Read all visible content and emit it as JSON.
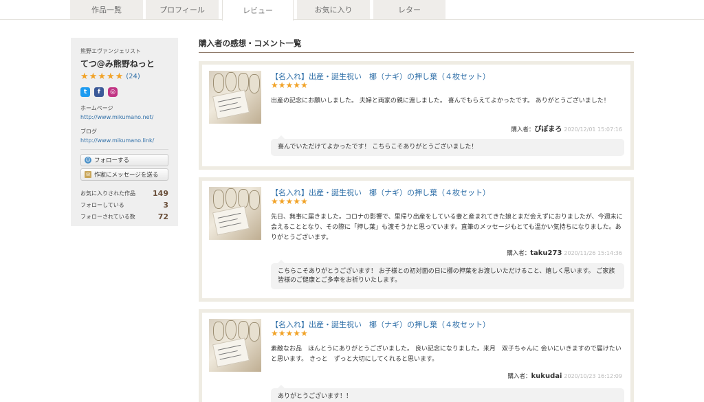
{
  "tabs": [
    {
      "label": "作品一覧",
      "active": false
    },
    {
      "label": "プロフィール",
      "active": false
    },
    {
      "label": "レビュー",
      "active": true
    },
    {
      "label": "お気に入り",
      "active": false
    },
    {
      "label": "レター",
      "active": false
    }
  ],
  "sidebar": {
    "subtitle": "熊野エヴァンジェリスト",
    "name": "てつ@み熊野ねっと",
    "rating_stars": 5,
    "review_count": "(24)",
    "homepage_label": "ホームページ",
    "homepage_url": "http://www.mikumano.net/",
    "blog_label": "ブログ",
    "blog_url": "http://www.mikumano.link/",
    "follow_button": "フォローする",
    "message_button": "作家にメッセージを送る",
    "stats": [
      {
        "label": "お気に入りされた作品",
        "value": "149"
      },
      {
        "label": "フォローしている",
        "value": "3"
      },
      {
        "label": "フォローされている数",
        "value": "72"
      }
    ]
  },
  "main": {
    "title": "購入者の感想・コメント一覧",
    "buyer_prefix": "購入者：",
    "reviews": [
      {
        "product": "【名入れ】出産・誕生祝い　梛（ナギ）の押し葉（４枚セット）",
        "stars": 5,
        "comment": "出産の記念にお願いしました。 夫婦と両家の親に渡しました。 喜んでもらえてよかったです。 ありがとうございました！",
        "buyer": "ぴぽまろ",
        "date": "2020/12/01 15:07:16",
        "reply": "喜んでいただけてよかったです！ こちらこそありがとうございました！"
      },
      {
        "product": "【名入れ】出産・誕生祝い　梛（ナギ）の押し葉（４枚セット）",
        "stars": 5,
        "comment": "先日、無事に届きました。コロナの影響で、里帰り出産をしている妻と産まれてきた娘とまだ会えずにおりましたが、今週末に会えることとなり、その際に「押し葉」も渡そうかと思っています。直筆のメッセージもとても温かい気持ちになりました。ありがとうございます。",
        "buyer": "taku273",
        "date": "2020/11/26 15:14:36",
        "reply": "こちらこそありがとうございます！ お子様との初対面の日に梛の押葉をお渡しいただけること、嬉しく思います。 ご家族皆様のご健康とご多幸をお祈りいたします。"
      },
      {
        "product": "【名入れ】出産・誕生祝い　梛（ナギ）の押し葉（４枚セット）",
        "stars": 5,
        "comment": "素敵なお品　ほんとうにありがとうございました。 良い記念になりました。来月　双子ちゃんに 会いにいきますので届けたいと思います。 きっと　ずっと大切にしてくれると思います。",
        "buyer": "kukudai",
        "date": "2020/10/23 16:12:09",
        "reply": "ありがとうございます！！"
      }
    ]
  },
  "colors": {
    "link": "#2f6fa8",
    "star": "#f1a226",
    "card_border": "#efece3",
    "sidebar_bg": "#efefef"
  }
}
